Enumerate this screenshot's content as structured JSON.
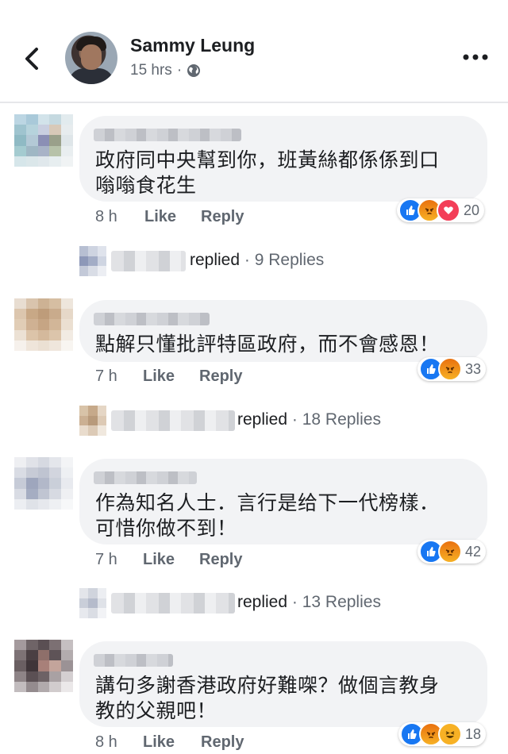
{
  "header": {
    "name": "Sammy Leung",
    "time": "15 hrs",
    "separator": "·"
  },
  "comments": [
    {
      "lines": [
        "政府同中央幫到你，班黃絲都係係到口",
        "嗡嗡食花生"
      ],
      "time": "8 h",
      "like": "Like",
      "reply": "Reply",
      "reactions": [
        "like",
        "angry",
        "love"
      ],
      "reaction_count": "20",
      "replied": "replied",
      "replies": "· 9 Replies"
    },
    {
      "lines": [
        "點解只懂批評特區政府，而不會感恩！"
      ],
      "time": "7 h",
      "like": "Like",
      "reply": "Reply",
      "reactions": [
        "like",
        "angry"
      ],
      "reaction_count": "33",
      "replied": "replied",
      "replies": "· 18 Replies"
    },
    {
      "lines": [
        "作為知名人士．言行是给下一代榜樣．",
        "可惜你做不到！"
      ],
      "time": "7 h",
      "like": "Like",
      "reply": "Reply",
      "reactions": [
        "like",
        "angry"
      ],
      "reaction_count": "42",
      "replied": "replied",
      "replies": "· 13 Replies"
    },
    {
      "lines": [
        "講句多謝香港政府好難㗎？做個言教身",
        "教的父親吧！"
      ],
      "time": "8 h",
      "like": "Like",
      "reply": "Reply",
      "reactions": [
        "like",
        "angry",
        "haha"
      ],
      "reaction_count": "18"
    }
  ],
  "colors": {
    "like": "#1877f2",
    "angry": "#f39c1f",
    "love": "#f33e58",
    "meta": "#606770",
    "bubble": "#f2f3f5"
  }
}
